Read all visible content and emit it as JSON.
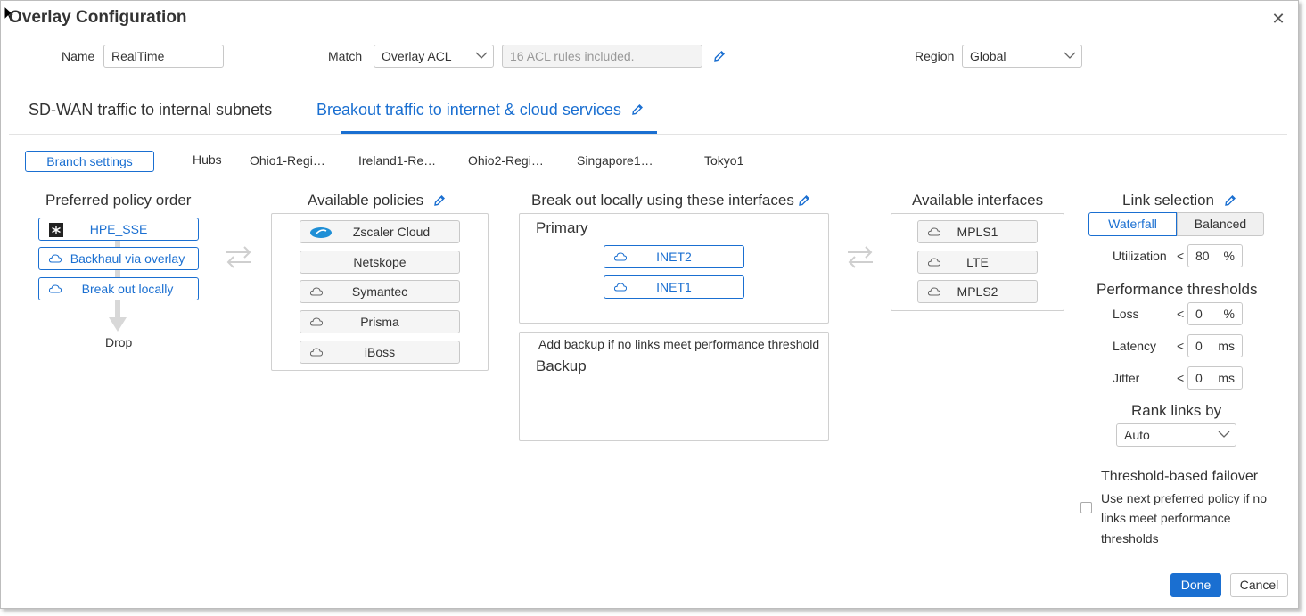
{
  "dialog": {
    "title": "Overlay Configuration",
    "close_icon": "close-icon"
  },
  "form": {
    "name_label": "Name",
    "name_value": "RealTime",
    "match_label": "Match",
    "match_value": "Overlay ACL",
    "acl_info": "16 ACL rules included.",
    "region_label": "Region",
    "region_value": "Global"
  },
  "tabs": [
    {
      "label": "SD-WAN traffic to internal subnets",
      "active": false
    },
    {
      "label": "Breakout traffic to internet & cloud services",
      "active": true
    }
  ],
  "subnav": {
    "branch_settings": "Branch settings",
    "hubs_label": "Hubs",
    "hubs": [
      "Ohio1-Regi…",
      "Ireland1-Re…",
      "Ohio2-Regi…",
      "Singapore1…",
      "Tokyo1"
    ]
  },
  "preferred_policy": {
    "title": "Preferred policy order",
    "items": [
      {
        "label": "HPE_SSE",
        "icon": "hpe-sse-logo-icon"
      },
      {
        "label": "Backhaul via overlay",
        "icon": "cloud-icon"
      },
      {
        "label": "Break out locally",
        "icon": "cloud-icon"
      }
    ],
    "drop_label": "Drop"
  },
  "available_policies": {
    "title": "Available policies",
    "items": [
      {
        "label": "Zscaler Cloud",
        "icon": "zscaler-logo-icon"
      },
      {
        "label": "Netskope",
        "icon": ""
      },
      {
        "label": "Symantec",
        "icon": "cloud-icon"
      },
      {
        "label": "Prisma",
        "icon": "cloud-icon"
      },
      {
        "label": "iBoss",
        "icon": "cloud-icon"
      }
    ]
  },
  "breakout": {
    "title": "Break out locally using these interfaces",
    "primary_label": "Primary",
    "primary_items": [
      "INET2",
      "INET1"
    ],
    "backup_hint": "Add backup if no links meet performance threshold",
    "backup_label": "Backup"
  },
  "available_interfaces": {
    "title": "Available interfaces",
    "items": [
      "MPLS1",
      "LTE",
      "MPLS2"
    ]
  },
  "link_selection": {
    "title": "Link selection",
    "modes": [
      "Waterfall",
      "Balanced"
    ],
    "active_mode": "Waterfall",
    "utilization_label": "Utilization",
    "utilization_op": "<",
    "utilization_value": "80",
    "utilization_unit": "%",
    "perf_title": "Performance thresholds",
    "loss_label": "Loss",
    "loss_op": "<",
    "loss_value": "0",
    "loss_unit": "%",
    "latency_label": "Latency",
    "latency_op": "<",
    "latency_value": "0",
    "latency_unit": "ms",
    "jitter_label": "Jitter",
    "jitter_op": "<",
    "jitter_value": "0",
    "jitter_unit": "ms",
    "rank_title": "Rank links by",
    "rank_value": "Auto",
    "failover_title": "Threshold-based failover",
    "failover_line1": "Use next preferred policy if no",
    "failover_line2": "links meet performance",
    "failover_line3": "thresholds",
    "failover_checked": false
  },
  "footer": {
    "done": "Done",
    "cancel": "Cancel"
  },
  "colors": {
    "accent": "#1a6fd1",
    "border": "#c8c8c8",
    "text": "#333333"
  }
}
